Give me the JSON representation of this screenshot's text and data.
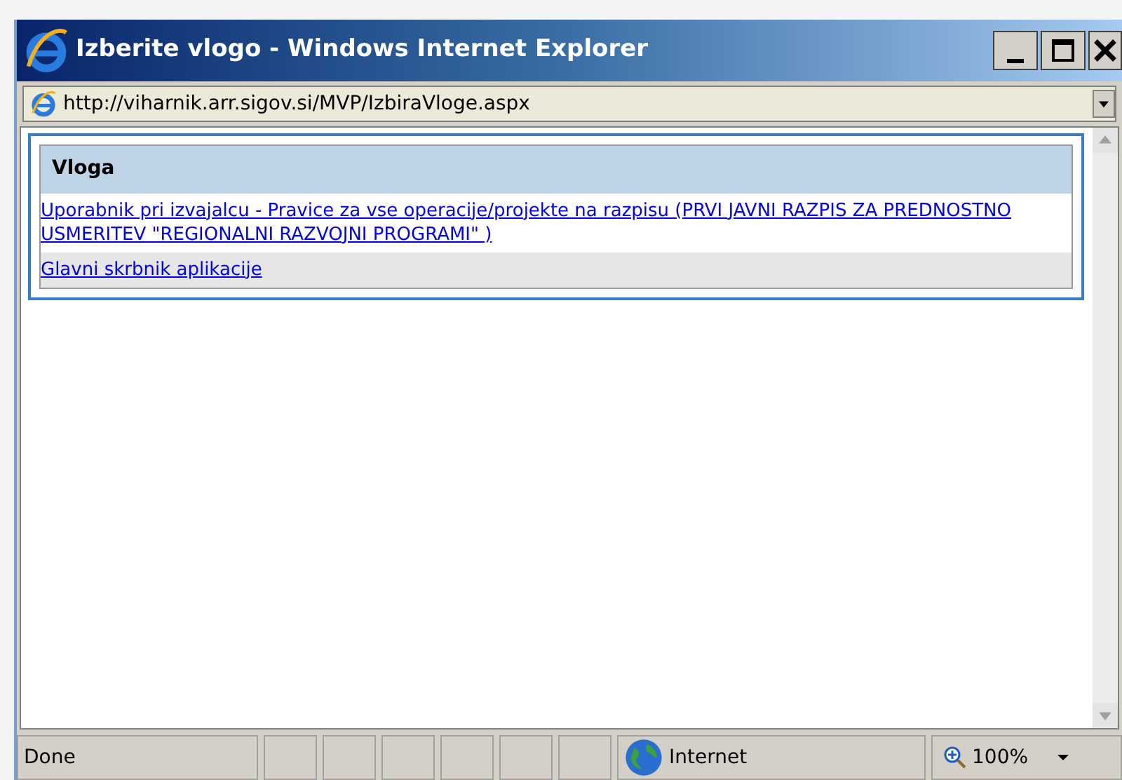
{
  "window": {
    "title": "Izberite vlogo - Windows Internet Explorer"
  },
  "address": "http://viharnik.arr.sigov.si/MVP/IzbiraVloge.aspx",
  "table": {
    "columns": [
      "Vloga"
    ],
    "rows": [
      {
        "link": "Uporabnik pri izvajalcu - Pravice za vse operacije/projekte na razpisu (PRVI JAVNI RAZPIS ZA PREDNOSTNO USMERITEV \"REGIONALNI RAZVOJNI PROGRAMI\" )"
      },
      {
        "link": "Glavni skrbnik aplikacije"
      }
    ]
  },
  "status_bar": {
    "text": "Done",
    "zone": "Internet",
    "zoom": "100%"
  }
}
